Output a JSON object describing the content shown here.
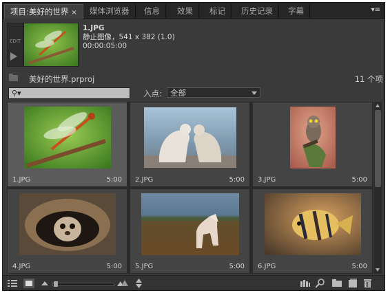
{
  "tabs": [
    {
      "label": "项目:美好的世界",
      "close": "×",
      "active": true
    },
    {
      "label": "媒体浏览器"
    },
    {
      "label": "信息"
    },
    {
      "label": "效果"
    },
    {
      "label": "标记"
    },
    {
      "label": "历史记录"
    },
    {
      "label": "字幕"
    }
  ],
  "panel_menu_icon": "▾≡",
  "preview": {
    "name": "1.JPG",
    "type": "静止图像，541 x 382 (1.0)",
    "duration": "00:00:05:00",
    "side_label": "EDIT"
  },
  "project": {
    "name": "美好的世界.prproj",
    "count": "11 个项"
  },
  "search": {
    "icon": "⚲▾",
    "value": ""
  },
  "in_point": {
    "label": "入点:",
    "value": "全部"
  },
  "clips": [
    {
      "name": "1.JPG",
      "duration": "5:00",
      "selected": true,
      "subject": "dragonfly"
    },
    {
      "name": "2.JPG",
      "duration": "5:00",
      "subject": "polar-bears"
    },
    {
      "name": "3.JPG",
      "duration": "5:00",
      "subject": "owl"
    },
    {
      "name": "4.JPG",
      "duration": "5:00",
      "subject": "meerkat"
    },
    {
      "name": "5.JPG",
      "duration": "5:00",
      "subject": "horse"
    },
    {
      "name": "6.JPG",
      "duration": "5:00",
      "subject": "fish"
    }
  ],
  "toolbar": {
    "list_view_icon": "list-view-icon",
    "icon_view_icon": "icon-view-icon",
    "zoom_level": 0.0
  },
  "colors": {
    "panel": "#3a3a3a",
    "tabbar": "#262626",
    "grid": "#2a2a2a",
    "cell": "#444444",
    "selected": "#5b5b5b"
  }
}
